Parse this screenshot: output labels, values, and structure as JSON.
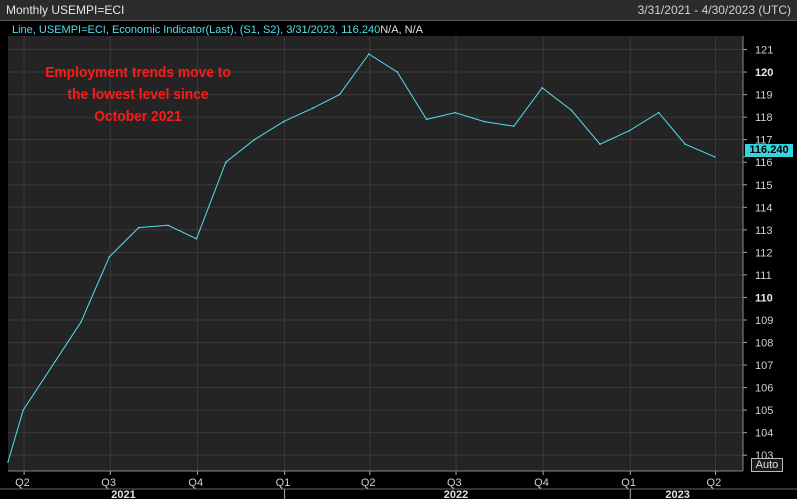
{
  "header": {
    "title": "Monthly USEMPI=ECI",
    "date_range": "3/31/2021 - 4/30/2023 (UTC)"
  },
  "legend": {
    "series": "Line, USEMPI=ECI, Economic Indicator(Last), (S1, S2), 3/31/2023, 116.240",
    "suffix": "N/A, N/A"
  },
  "annotation": {
    "line1": "Employment trends move to",
    "line2": "the lowest level since",
    "line3": "October 2021"
  },
  "last_value_label": "116.240",
  "auto_button": "Auto",
  "colors": {
    "background": "#000000",
    "plot_area": "#242424",
    "line": "#4fe0ee",
    "annotation": "#ff1a1a",
    "grid": "#3a3a3a"
  },
  "chart_data": {
    "type": "line",
    "title": "Monthly USEMPI=ECI",
    "xlabel": "",
    "ylabel": "",
    "ylim": [
      102.3,
      121.6
    ],
    "xlim": [
      "2021-03-15",
      "2023-04-30"
    ],
    "grid": true,
    "series": [
      {
        "name": "USEMPI=ECI",
        "points": [
          {
            "x": "2021-03-15",
            "y": 102.7
          },
          {
            "x": "2021-03-31",
            "y": 105.0
          },
          {
            "x": "2021-05-31",
            "y": 108.9
          },
          {
            "x": "2021-06-30",
            "y": 111.8
          },
          {
            "x": "2021-07-31",
            "y": 113.1
          },
          {
            "x": "2021-08-31",
            "y": 113.2
          },
          {
            "x": "2021-09-30",
            "y": 112.6
          },
          {
            "x": "2021-10-31",
            "y": 116.0
          },
          {
            "x": "2021-11-30",
            "y": 117.0
          },
          {
            "x": "2021-12-31",
            "y": 117.8
          },
          {
            "x": "2022-01-31",
            "y": 118.4
          },
          {
            "x": "2022-02-28",
            "y": 119.0
          },
          {
            "x": "2022-03-31",
            "y": 120.8
          },
          {
            "x": "2022-04-30",
            "y": 120.0
          },
          {
            "x": "2022-05-31",
            "y": 117.9
          },
          {
            "x": "2022-06-30",
            "y": 118.2
          },
          {
            "x": "2022-07-31",
            "y": 117.8
          },
          {
            "x": "2022-08-31",
            "y": 117.6
          },
          {
            "x": "2022-09-30",
            "y": 119.3
          },
          {
            "x": "2022-10-31",
            "y": 118.3
          },
          {
            "x": "2022-11-30",
            "y": 116.8
          },
          {
            "x": "2022-12-31",
            "y": 117.4
          },
          {
            "x": "2023-01-31",
            "y": 118.2
          },
          {
            "x": "2023-02-28",
            "y": 116.8
          },
          {
            "x": "2023-03-31",
            "y": 116.24
          }
        ]
      }
    ],
    "y_ticks": [
      {
        "label": "103",
        "value": 103,
        "bold": false
      },
      {
        "label": "104",
        "value": 104,
        "bold": false
      },
      {
        "label": "105",
        "value": 105,
        "bold": false
      },
      {
        "label": "106",
        "value": 106,
        "bold": false
      },
      {
        "label": "107",
        "value": 107,
        "bold": false
      },
      {
        "label": "108",
        "value": 108,
        "bold": false
      },
      {
        "label": "109",
        "value": 109,
        "bold": false
      },
      {
        "label": "110",
        "value": 110,
        "bold": true
      },
      {
        "label": "111",
        "value": 111,
        "bold": false
      },
      {
        "label": "112",
        "value": 112,
        "bold": false
      },
      {
        "label": "113",
        "value": 113,
        "bold": false
      },
      {
        "label": "114",
        "value": 114,
        "bold": false
      },
      {
        "label": "115",
        "value": 115,
        "bold": false
      },
      {
        "label": "116",
        "value": 116,
        "bold": false
      },
      {
        "label": "117",
        "value": 117,
        "bold": false
      },
      {
        "label": "118",
        "value": 118,
        "bold": false
      },
      {
        "label": "119",
        "value": 119,
        "bold": false
      },
      {
        "label": "120",
        "value": 120,
        "bold": true
      },
      {
        "label": "121",
        "value": 121,
        "bold": false
      }
    ],
    "x_ticks": [
      {
        "label": "Q2",
        "date": "2021-04-01"
      },
      {
        "label": "Q3",
        "date": "2021-07-01"
      },
      {
        "label": "Q4",
        "date": "2021-10-01"
      },
      {
        "label": "Q1",
        "date": "2022-01-01"
      },
      {
        "label": "Q2",
        "date": "2022-04-01"
      },
      {
        "label": "Q3",
        "date": "2022-07-01"
      },
      {
        "label": "Q4",
        "date": "2022-10-01"
      },
      {
        "label": "Q1",
        "date": "2023-01-01"
      },
      {
        "label": "Q2",
        "date": "2023-04-01"
      }
    ],
    "year_labels": [
      {
        "label": "2021",
        "date": "2021-07-15"
      },
      {
        "label": "2022",
        "date": "2022-07-01"
      },
      {
        "label": "2023",
        "date": "2023-02-20"
      }
    ],
    "year_dividers": [
      "2022-01-01",
      "2023-01-01"
    ]
  }
}
